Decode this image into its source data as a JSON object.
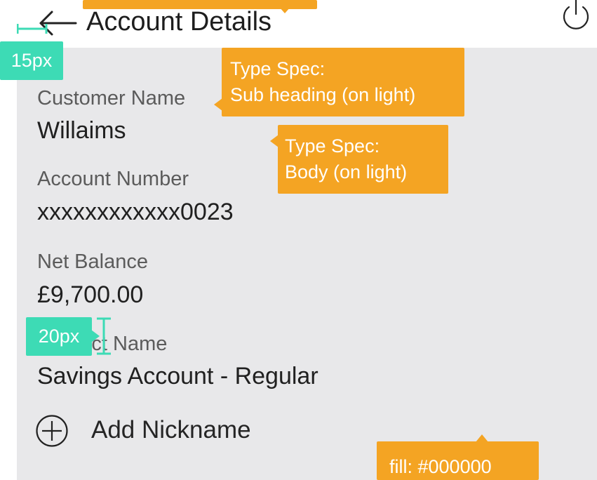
{
  "header": {
    "title": "Account Details",
    "back_icon": "arrow-left-icon",
    "power_icon": "power-icon"
  },
  "account": {
    "customer_name_label": "Customer Name",
    "customer_name_value": "Willaims",
    "account_number_label": "Account Number",
    "account_number_value": "xxxxxxxxxxxx0023",
    "net_balance_label": "Net Balance",
    "net_balance_value": "£9,700.00",
    "product_name_label": "Product Name",
    "product_name_value": "Savings Account - Regular"
  },
  "actions": {
    "add_nickname": "Add Nickname",
    "add_icon": "plus-circle-icon"
  },
  "annotations": {
    "subheading_spec": "Type Spec:\nSub heading (on light)",
    "body_spec": "Type Spec:\nBody (on light)",
    "fill_spec": "fill: #000000",
    "measure_15": "15px",
    "measure_20": "20px"
  },
  "colors": {
    "annotation_orange": "#f4a423",
    "measure_teal": "#3ddbb5",
    "card_background": "#e8e8ea"
  }
}
